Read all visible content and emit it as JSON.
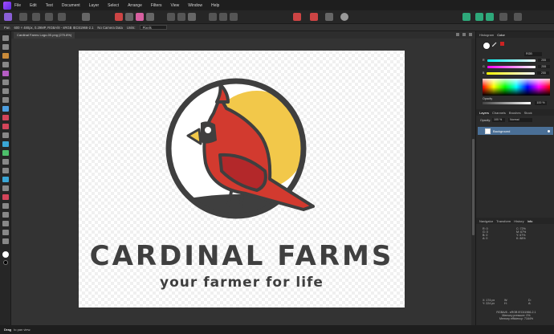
{
  "menu": [
    "File",
    "Edit",
    "Text",
    "Document",
    "Layer",
    "Select",
    "Arrange",
    "Filters",
    "View",
    "Window",
    "Help"
  ],
  "context": {
    "tool": "Pan",
    "doc_info": "600 × 480px, 0.29MP, RGBA/8 - sRGB IEC61966-2.1",
    "camera": "No Camera Data",
    "units_label": "Units:",
    "units_value": "Pixels"
  },
  "tab": {
    "title": "Cardinal Farms Logo-00.png (270.8%)"
  },
  "colors": {
    "accent": "#4a6f96",
    "app_bg": "#2b2b2b",
    "cardinal_red": "#d23a2f",
    "sun_yellow": "#f2c84a",
    "ink": "#3f3f3f"
  },
  "artwork": {
    "brand_name": "CARDINAL FARMS",
    "tagline": "your farmer for life"
  },
  "color_panel": {
    "tabs": [
      "Histogram",
      "Color"
    ],
    "mode": "RGB",
    "r_label": "R",
    "r_value": "255",
    "g_label": "G",
    "g_value": "255",
    "b_label": "B",
    "b_value": "255",
    "opacity_label": "Opacity",
    "opacity_value": "100 %"
  },
  "layers_panel": {
    "tabs": [
      "Layers",
      "Channels",
      "Brushes",
      "Stock"
    ],
    "opacity_label": "Opacity:",
    "opacity_value": "100 %",
    "blend_mode": "Normal",
    "layer_name": "Background"
  },
  "info_panel": {
    "tabs": [
      "Navigator",
      "Transform",
      "History",
      "Info"
    ],
    "col1": [
      {
        "k": "R:",
        "v": "0"
      },
      {
        "k": "G:",
        "v": "0"
      },
      {
        "k": "B:",
        "v": "0"
      },
      {
        "k": "A:",
        "v": "0"
      }
    ],
    "col2": [
      {
        "k": "C:",
        "v": "72%"
      },
      {
        "k": "M:",
        "v": "67%"
      },
      {
        "k": "Y:",
        "v": "67%"
      },
      {
        "k": "K:",
        "v": "88%"
      }
    ],
    "pos_x": "X: 174 px",
    "pos_y": "Y: 224 px",
    "w": "W:",
    "h": "H:",
    "d": "D:",
    "a": "A:",
    "color_profile": "RGBA/8 - sRGB IEC61966-2.1",
    "memory_pressure": "Memory pressure: 0%",
    "memory_efficiency": "Memory efficiency: 7164%"
  },
  "status": {
    "action": "Drag",
    "hint": "to pan view."
  }
}
